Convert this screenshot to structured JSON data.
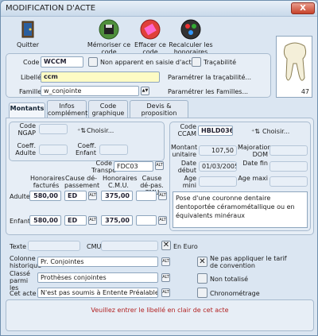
{
  "window": {
    "title": "MODIFICATION D'ACTE",
    "close": "X"
  },
  "toolbar": {
    "quit": "Quitter",
    "memorise": "Mémoriser ce code",
    "erase": "Effacer ce code",
    "recalc": "Recalculer les honoraires"
  },
  "tooth": {
    "number": "47"
  },
  "header": {
    "code_label": "Code",
    "code_value": "WCCM",
    "not_shown_label": "Non apparent en saisie d'actes",
    "traceability_label": "Traçabilité",
    "libelle_label": "Libellé",
    "libelle_value": "ccm",
    "param_traceability": "Paramétrer la traçabilité...",
    "famille_label": "Famille",
    "famille_value": "w_conjointe",
    "param_families": "Paramétrer les Familles..."
  },
  "tabs": [
    "Montants",
    "Infos complément.",
    "Code graphique",
    "Devis & proposition thérapeutique"
  ],
  "ngap": {
    "code_label": "Code NGAP",
    "choose": "Choisir...",
    "coeff_adulte": "Coeff. Adulte",
    "coeff_enfant": "Coeff. Enfant"
  },
  "ccam": {
    "code_label": "Code CCAM",
    "code_value": "HBLD036",
    "choose": "Choisir...",
    "montant_label": "Montant unitaire",
    "montant_value": "107,50",
    "majoration_label": "Majoration DOM",
    "date_debut_label": "Date début",
    "date_debut_value": "01/03/2005",
    "date_fin_label": "Date fin",
    "age_mini_label": "Age mini",
    "age_maxi_label": "Age maxi",
    "description": "Pose d'une couronne dentaire dentoportée céramométallique ou en équivalents minéraux"
  },
  "fees": {
    "code_transpo_label": "Code Transpo",
    "code_transpo_value": "FDC03",
    "col_honoraires": "Honoraires facturés",
    "col_cause_dep": "Cause dé-passement",
    "col_hono_cmu": "Honoraires C.M.U.",
    "col_cause_cmu": "Cause dé-pas. CMU",
    "rows": [
      {
        "label": "Adulte",
        "honoraires": "580,00",
        "cause": "ED",
        "cmu": "375,00"
      },
      {
        "label": "Enfant",
        "honoraires": "580,00",
        "cause": "ED",
        "cmu": "375,00"
      }
    ]
  },
  "bottom": {
    "texte_label": "Texte",
    "cmu_label": "CMU",
    "en_euro": "En Euro",
    "colonne_label": "Colonne historique",
    "colonne_value": "Pr. Conjointes",
    "classe_label": "Classé parmi les",
    "classe_value": "Prothèses conjointes",
    "cet_acte_label": "Cet acte",
    "cet_acte_value": "N'est pas soumis à Entente Préalable",
    "no_tarif_label": "Ne pas appliquer le tarif de convention",
    "non_totalise": "Non totalisé",
    "chrono": "Chronométrage"
  },
  "status": {
    "message": "Veuillez entrer le libellé en clair de cet acte"
  }
}
